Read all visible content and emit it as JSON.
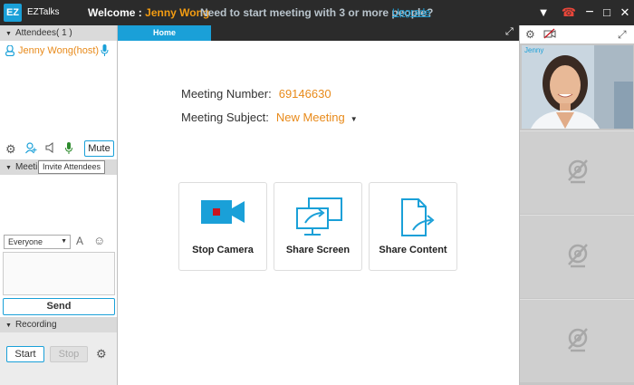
{
  "titlebar": {
    "logo": "EZ",
    "app_name": "EZTalks",
    "welcome_label": "Welcome :",
    "user_name": "Jenny Wong",
    "promo": "Need to start meeting with 3 or more people?",
    "upgrade": "Upgrade",
    "icons": [
      "dropdown-icon",
      "alert-icon",
      "minimize-icon",
      "maximize-icon",
      "close-icon"
    ]
  },
  "attendees": {
    "header": "Attendees( 1 )",
    "items": [
      {
        "name": "Jenny Wong(host)"
      }
    ],
    "mute": "Mute",
    "tooltip": "Invite Attendees"
  },
  "meeting_chat": {
    "header": "Meeting",
    "recipient": "Everyone",
    "send": "Send"
  },
  "recording": {
    "header": "Recording",
    "start": "Start",
    "stop": "Stop"
  },
  "center": {
    "tab": "Home",
    "meeting_number_label": "Meeting Number:",
    "meeting_number": "69146630",
    "meeting_subject_label": "Meeting Subject:",
    "meeting_subject": "New Meeting",
    "actions": [
      {
        "label": "Stop Camera",
        "icon": "camera-icon"
      },
      {
        "label": "Share Screen",
        "icon": "share-screen-icon"
      },
      {
        "label": "Share Content",
        "icon": "share-content-icon"
      }
    ]
  },
  "video": {
    "main_label": "Jenny"
  },
  "colors": {
    "accent": "#1aa0d8",
    "highlight": "#e88a1a",
    "titlebar": "#2b2b2b"
  }
}
